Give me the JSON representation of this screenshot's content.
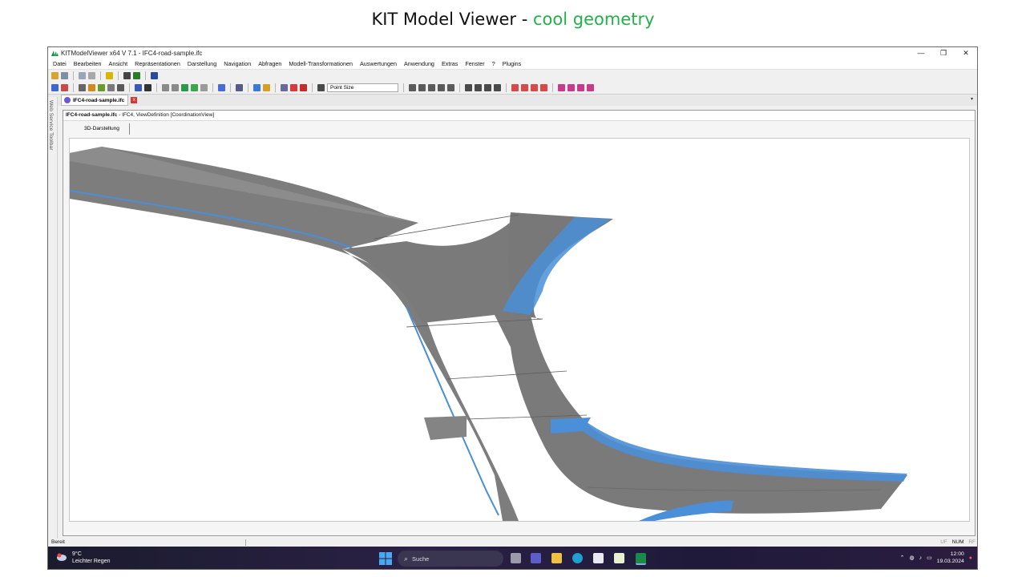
{
  "slide": {
    "title_prefix": "KIT Model Viewer - ",
    "title_accent": "cool geometry"
  },
  "window": {
    "title": "KITModelViewer x64 V 7.1 - IFC4-road-sample.ifc",
    "controls": {
      "minimize": "—",
      "restore": "❐",
      "close": "✕"
    }
  },
  "menu": [
    "Datei",
    "Bearbeiten",
    "Ansicht",
    "Repräsentationen",
    "Darstellung",
    "Navigation",
    "Abfragen",
    "Modell-Transformationen",
    "Auswertungen",
    "Anwendung",
    "Extras",
    "Fenster",
    "?",
    "Plugins"
  ],
  "toolbar": {
    "point_size_value": "Point Size"
  },
  "side_strip": {
    "label": "Web Service Toolbar"
  },
  "doc_tab": {
    "label": "IFC4-road-sample.ifc",
    "close": "x",
    "dropdown": "▾"
  },
  "doc_info": {
    "file": "IFC4-road-sample.ifc",
    "details": " - IFC4, ViewDefinition [CoordinationView]"
  },
  "view_tab": {
    "label": "3D-Darstellung"
  },
  "status": {
    "text": "Bereit",
    "indicators": [
      "UF",
      "NUM",
      "RF"
    ]
  },
  "taskbar": {
    "weather_temp": "9°C",
    "weather_desc": "Leichter Regen",
    "search_placeholder": "Suche",
    "time": "12:00",
    "date": "19.03.2024"
  },
  "colors": {
    "accent": "#22b04a",
    "road_surface": "#7a7a7a",
    "road_marking": "#4a8fd8"
  }
}
